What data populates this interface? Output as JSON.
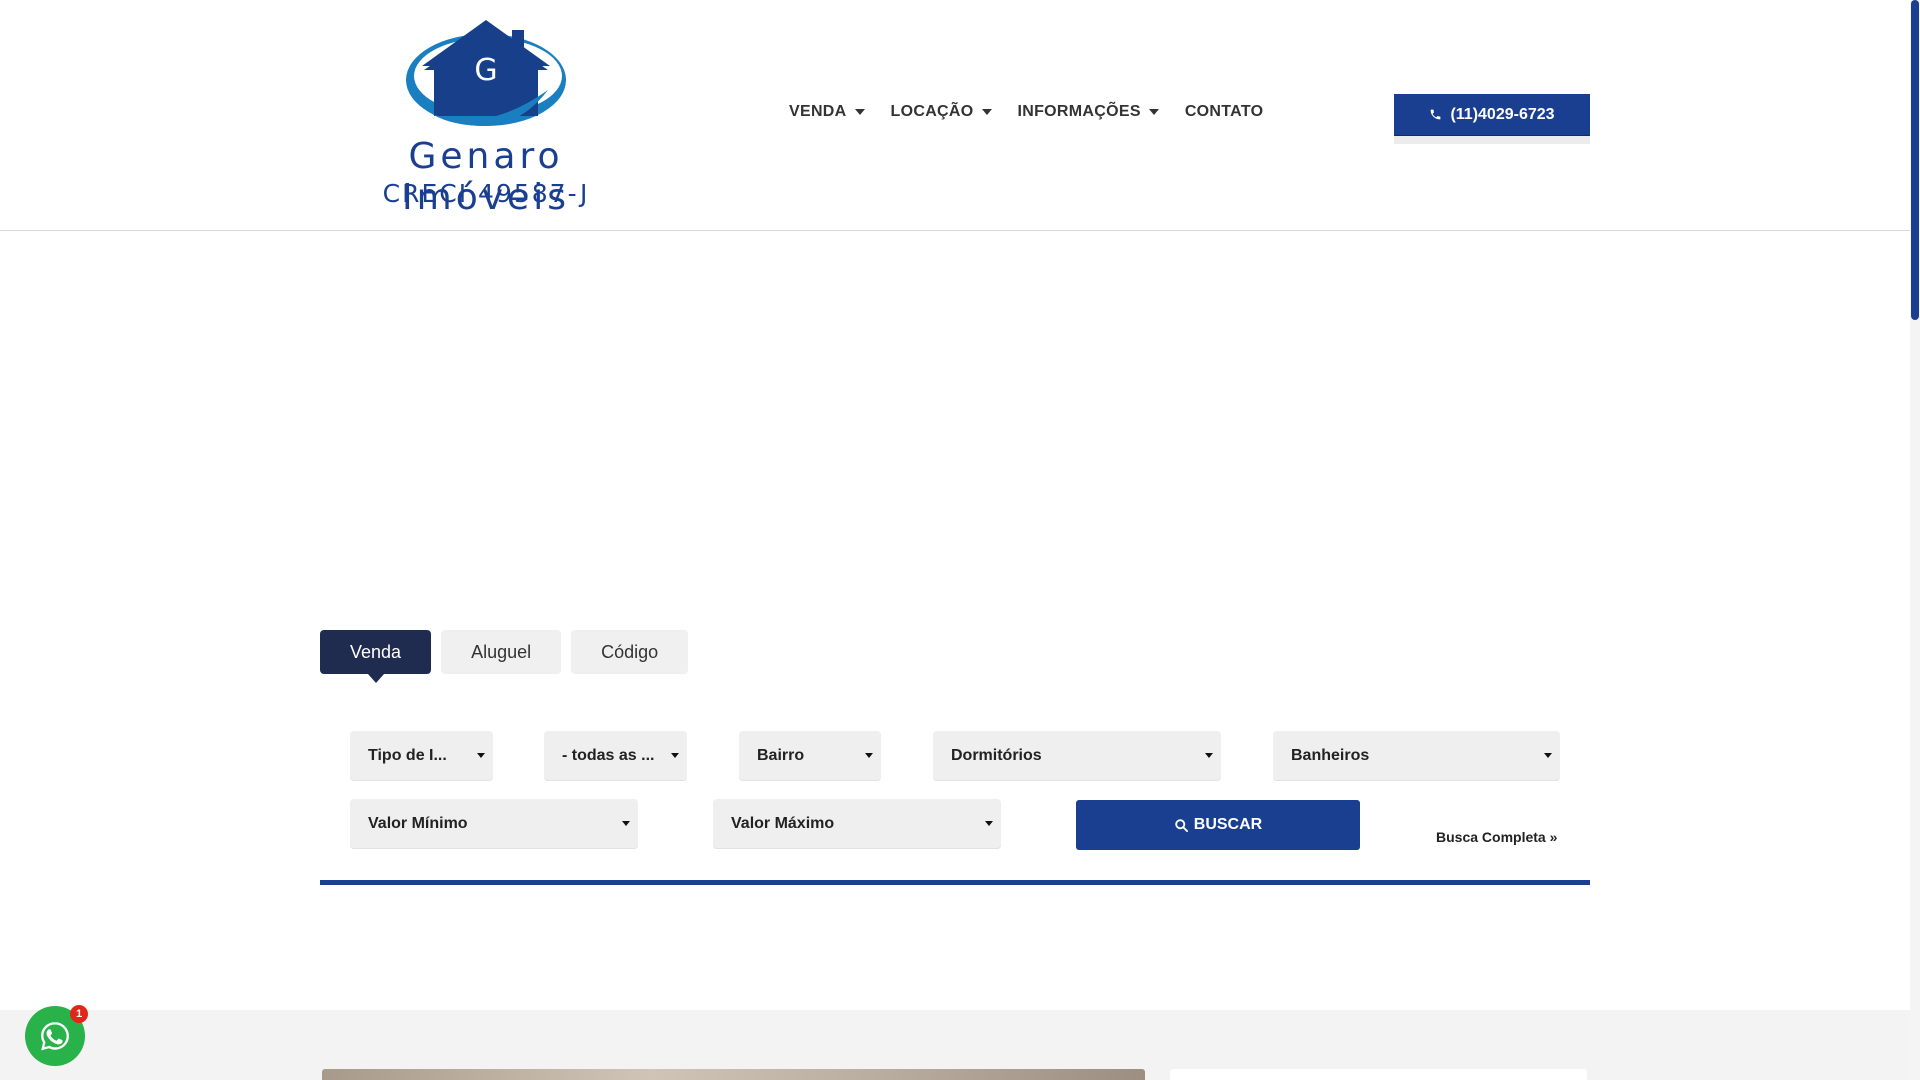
{
  "logo": {
    "initial": "G",
    "brand": "Genaro Imóveis",
    "creci": "CRECI 49587-J",
    "color": "#1a3f91",
    "icon": "house-logo-icon"
  },
  "nav": {
    "items": [
      {
        "label": "VENDA",
        "dropdown": true
      },
      {
        "label": "LOCAÇÃO",
        "dropdown": true
      },
      {
        "label": "INFORMAÇÕES",
        "dropdown": true
      },
      {
        "label": "CONTATO",
        "dropdown": false
      }
    ]
  },
  "phone": {
    "label": "(11)4029-6723",
    "icon": "phone-icon"
  },
  "tabs": [
    {
      "label": "Venda",
      "active": true
    },
    {
      "label": "Aluguel",
      "active": false
    },
    {
      "label": "Código",
      "active": false
    }
  ],
  "search": {
    "tipo": "Tipo de I...",
    "cidades": "- todas as ...",
    "bairro": "Bairro",
    "dormitorios": "Dormitórios",
    "banheiros": "Banheiros",
    "valor_minimo": "Valor Mínimo",
    "valor_maximo": "Valor Máximo",
    "buscar_label": "BUSCAR",
    "busca_completa": "Busca Completa »"
  },
  "whatsapp": {
    "badge": "1",
    "icon": "whatsapp-icon",
    "color": "#2ab24a"
  },
  "colors": {
    "primary": "#1a3f91",
    "tab_active": "#1f2b4f"
  }
}
